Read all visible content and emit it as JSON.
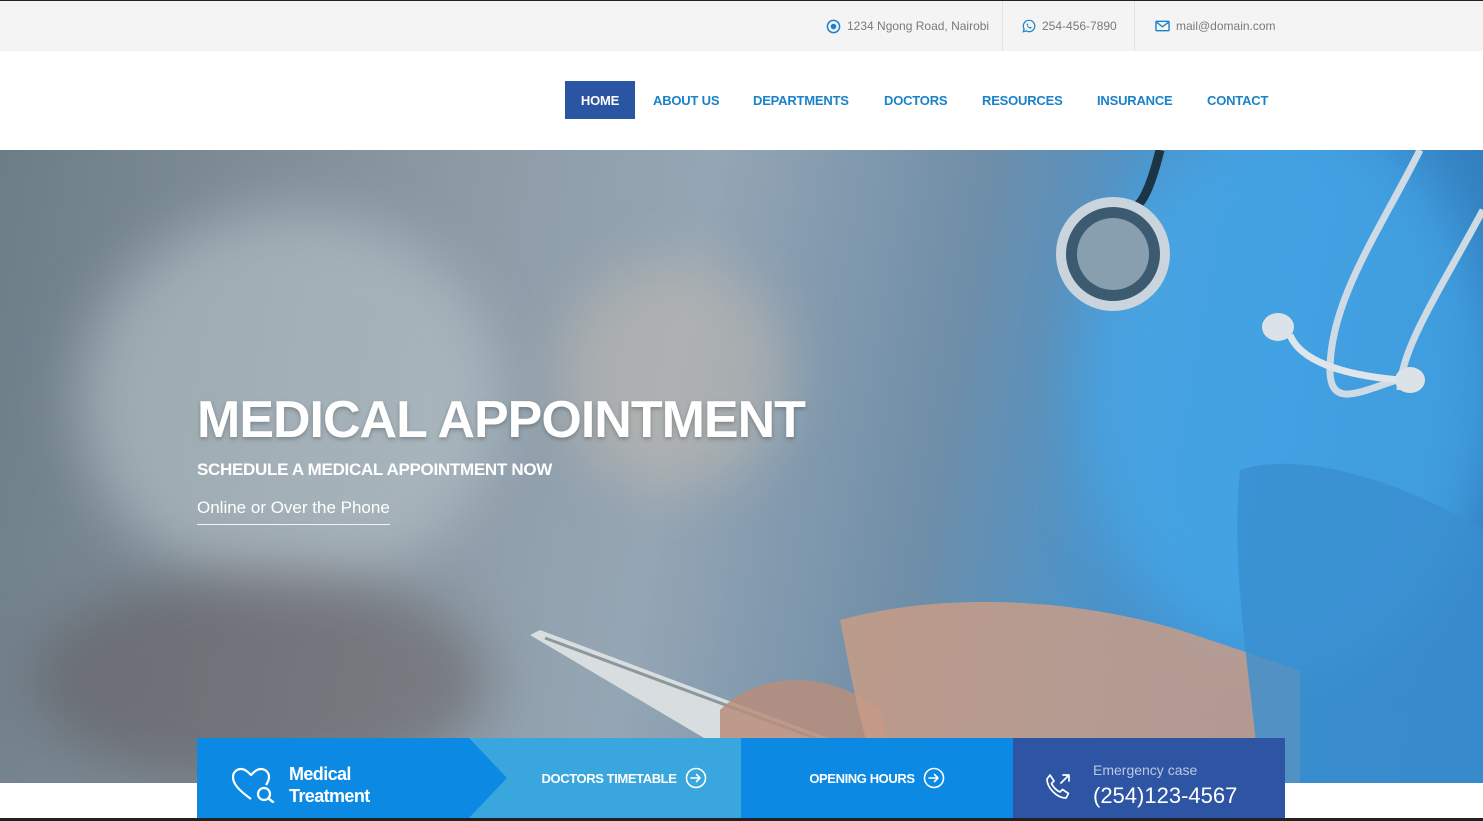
{
  "topbar": {
    "address": "1234 Ngong Road, Nairobi",
    "phone": "254-456-7890",
    "email": "mail@domain.com"
  },
  "nav": {
    "items": [
      {
        "label": "HOME",
        "active": true
      },
      {
        "label": "ABOUT US"
      },
      {
        "label": "DEPARTMENTS"
      },
      {
        "label": "DOCTORS"
      },
      {
        "label": "RESOURCES"
      },
      {
        "label": "INSURANCE"
      },
      {
        "label": "CONTACT"
      }
    ]
  },
  "hero": {
    "title": "MEDICAL APPOINTMENT",
    "subtitle": "SCHEDULE A MEDICAL APPOINTMENT NOW",
    "link": "Online or Over the Phone"
  },
  "features": {
    "medical_line1": "Medical",
    "medical_line2": "Treatment",
    "timetable": "DOCTORS TIMETABLE",
    "opening": "OPENING HOURS",
    "emergency_label": "Emergency case",
    "emergency_phone": "(254)123-4567"
  },
  "colors": {
    "accent": "#0c8ae3",
    "nav_active": "#2a55a3",
    "nav_text": "#1a82c9",
    "emergency_bg": "#2e55a4"
  }
}
